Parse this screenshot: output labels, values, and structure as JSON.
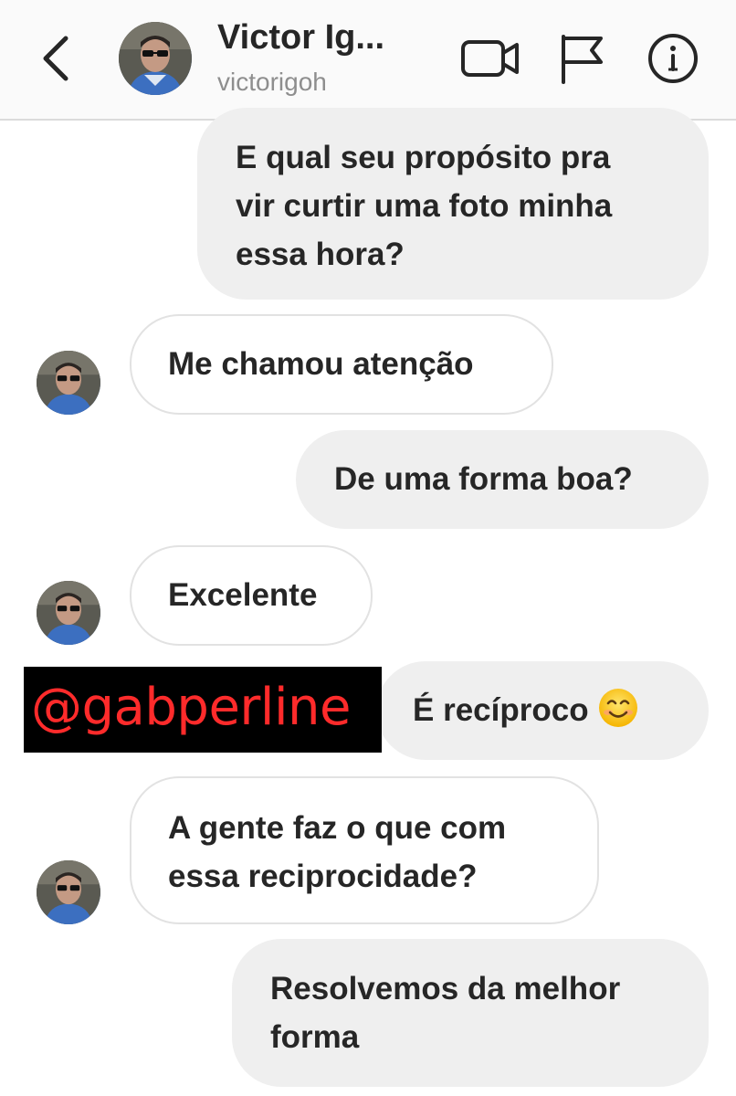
{
  "header": {
    "name": "Victor Ig...",
    "username": "victorigoh",
    "icons": [
      "back-chevron-icon",
      "video-camera-icon",
      "flag-icon",
      "info-icon"
    ]
  },
  "messages": [
    {
      "from": "me",
      "text": "E qual seu propósito pra\nvir curtir uma foto minha\nessa hora?"
    },
    {
      "from": "them",
      "text": "Me chamou atenção"
    },
    {
      "from": "me",
      "text": "De uma forma boa?"
    },
    {
      "from": "them",
      "text": "Excelente"
    },
    {
      "from": "me",
      "text": "É recíproco",
      "emoji": "smiling-face-icon"
    },
    {
      "from": "them",
      "text": "A gente faz o que com\nessa reciprocidade?"
    },
    {
      "from": "me",
      "text": "Resolvemos da melhor\nforma"
    }
  ],
  "watermark": {
    "text": "@gabperline"
  },
  "colors": {
    "header_bg": "#fafafa",
    "outgoing_bubble": "#efefef",
    "incoming_border": "#e2e2e2",
    "username_gray": "#8e8e8e",
    "watermark_text": "#ff2b2b"
  }
}
